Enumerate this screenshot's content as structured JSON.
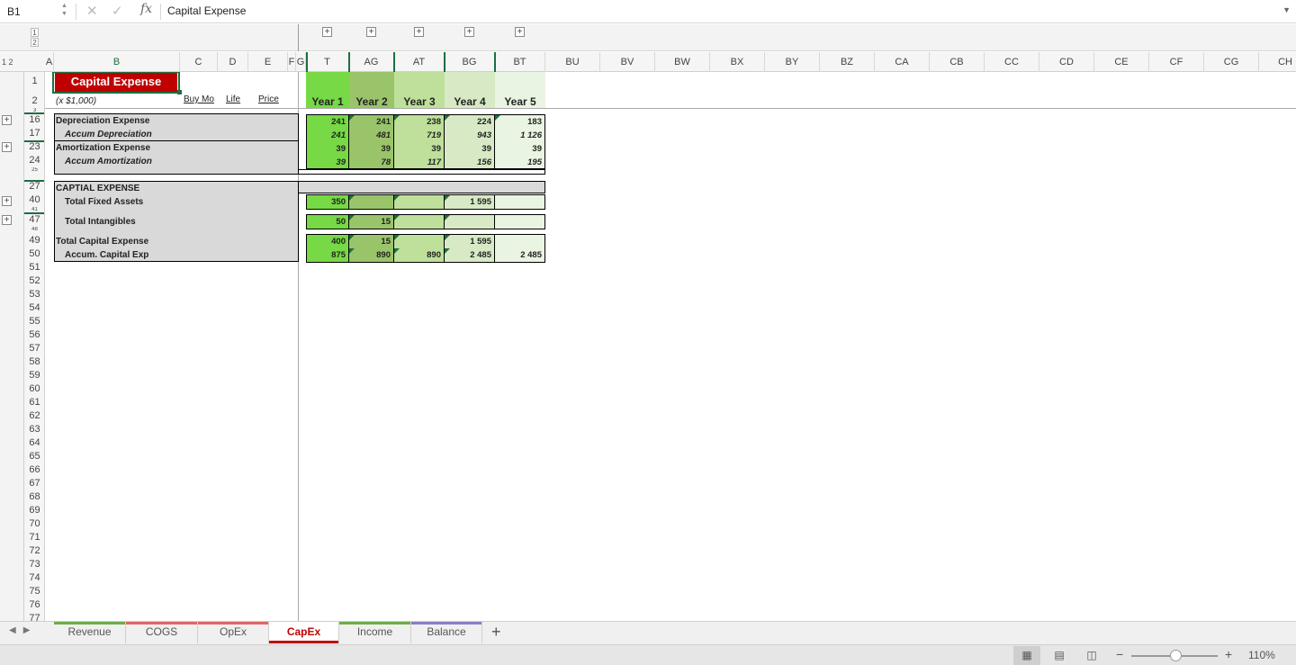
{
  "formula_bar": {
    "cell_ref": "B1",
    "fx_label": "fx",
    "content": "Capital Expense"
  },
  "outline": {
    "col_levels": [
      "1",
      "2"
    ],
    "row_levels": "1 2"
  },
  "columns": [
    "A",
    "B",
    "C",
    "D",
    "E",
    "F",
    "G",
    "T",
    "AG",
    "AT",
    "BG",
    "BT",
    "BU",
    "BV",
    "BW",
    "BX",
    "BY",
    "BZ",
    "CA",
    "CB",
    "CC",
    "CD",
    "CE",
    "CF",
    "CG",
    "CH"
  ],
  "rows": [
    "1",
    "2",
    "3",
    "16",
    "17",
    "23",
    "24",
    "25",
    "27",
    "40",
    "41",
    "47",
    "48",
    "49",
    "50",
    "51",
    "52",
    "53",
    "54",
    "55",
    "56",
    "57",
    "58",
    "59",
    "60",
    "61",
    "62",
    "63",
    "64",
    "65",
    "66",
    "67",
    "68",
    "69",
    "70",
    "71",
    "72",
    "73",
    "74",
    "75",
    "76",
    "77"
  ],
  "sheet": {
    "title": "Capital Expense",
    "units": "(x $1,000)",
    "headers": {
      "buy_mo": "Buy Mo",
      "life": "Life",
      "price": "Price"
    },
    "years": [
      "Year 1",
      "Year 2",
      "Year 3",
      "Year 4",
      "Year 5"
    ],
    "year_colors": [
      "#77d946",
      "#9ac46a",
      "#bee09a",
      "#d7eac5",
      "#eaf4e2"
    ],
    "rows": [
      {
        "label": "Depreciation Expense",
        "values": [
          "241",
          "241",
          "238",
          "224",
          "183"
        ],
        "italic": false
      },
      {
        "label": "Accum Depreciation",
        "values": [
          "241",
          "481",
          "719",
          "943",
          "1 126"
        ],
        "italic": true
      },
      {
        "label": "Amortization Expense",
        "values": [
          "39",
          "39",
          "39",
          "39",
          "39"
        ],
        "italic": false
      },
      {
        "label": "Accum Amortization",
        "values": [
          "39",
          "78",
          "117",
          "156",
          "195"
        ],
        "italic": true
      }
    ],
    "capital_header": "CAPTIAL EXPENSE",
    "fixed_assets": {
      "label": "Total Fixed Assets",
      "values": [
        "350",
        "",
        "",
        "1 595",
        ""
      ]
    },
    "intangibles": {
      "label": "Total Intangibles",
      "values": [
        "50",
        "15",
        "",
        "",
        ""
      ]
    },
    "total_capex": {
      "label": "Total Capital Expense",
      "values": [
        "400",
        "15",
        "",
        "1 595",
        ""
      ]
    },
    "accum_capex": {
      "label": "Accum. Capital Exp",
      "values": [
        "875",
        "890",
        "890",
        "2 485",
        "2 485"
      ]
    }
  },
  "tabs": [
    {
      "label": "Revenue",
      "color": "#70ad47"
    },
    {
      "label": "COGS",
      "color": "#e06666"
    },
    {
      "label": "OpEx",
      "color": "#e06666"
    },
    {
      "label": "CapEx",
      "color": "#c00000"
    },
    {
      "label": "Income",
      "color": "#70ad47"
    },
    {
      "label": "Balance",
      "color": "#8e7cc3"
    }
  ],
  "add_sheet": "+",
  "status": {
    "zoom": "110%",
    "zoom_minus": "−",
    "zoom_plus": "+"
  }
}
